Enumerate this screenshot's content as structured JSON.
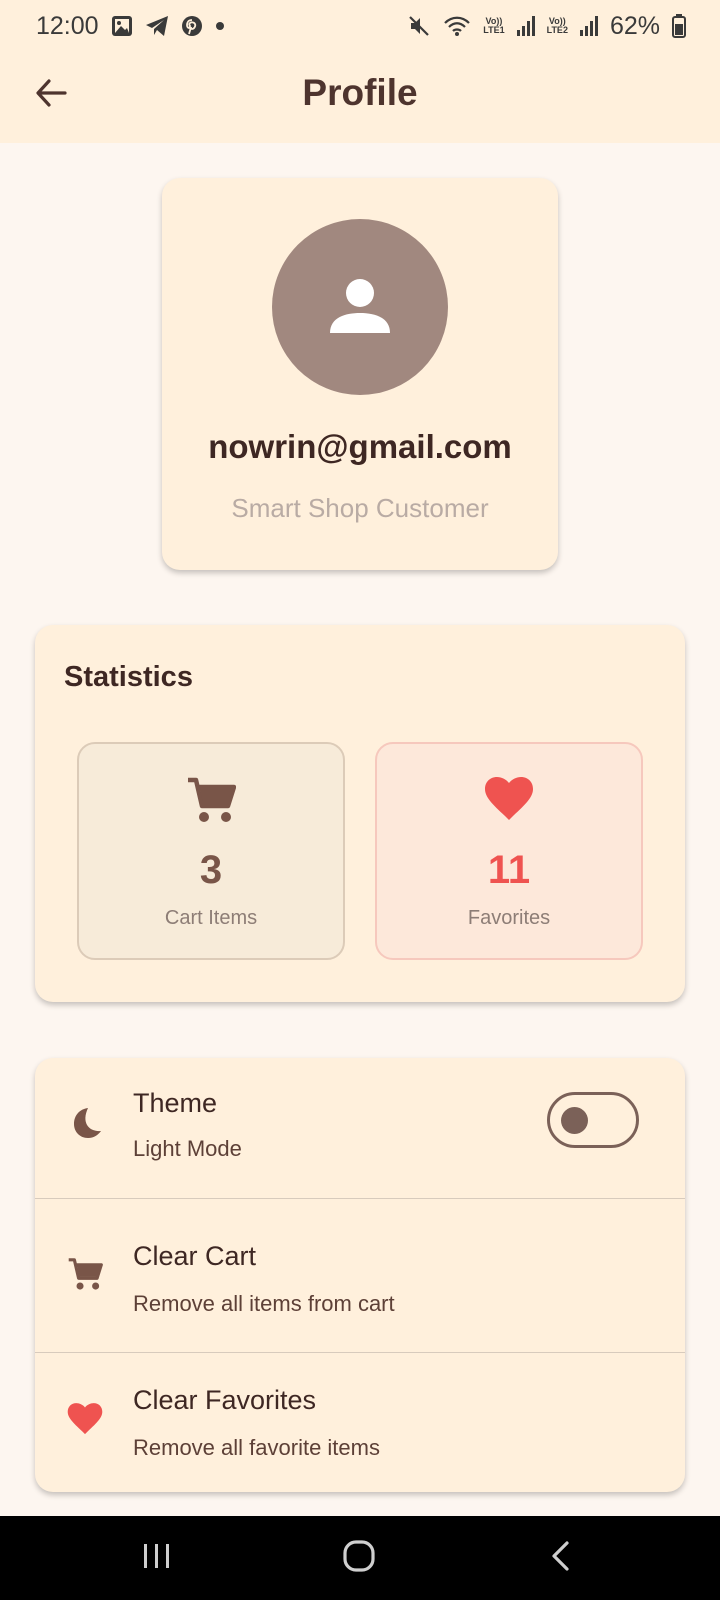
{
  "status_bar": {
    "time": "12:00",
    "battery": "62%",
    "lte1": "LTE1",
    "lte2": "LTE2",
    "volte": "Vo))"
  },
  "app_bar": {
    "title": "Profile",
    "back_icon": "arrow-left-icon"
  },
  "profile": {
    "avatar_icon": "person-icon",
    "email": "nowrin@gmail.com",
    "role": "Smart Shop Customer"
  },
  "statistics": {
    "title": "Statistics",
    "items": [
      {
        "icon": "cart-icon",
        "value": "3",
        "label": "Cart Items",
        "color": "#795548"
      },
      {
        "icon": "heart-icon",
        "value": "11",
        "label": "Favorites",
        "color": "#ef5350"
      }
    ]
  },
  "settings": {
    "items": [
      {
        "icon": "moon-icon",
        "title": "Theme",
        "subtitle": "Light Mode",
        "toggle_on": false
      },
      {
        "icon": "cart-icon",
        "title": "Clear Cart",
        "subtitle": "Remove all items from cart"
      },
      {
        "icon": "heart-icon",
        "title": "Clear Favorites",
        "subtitle": "Remove all favorite items"
      }
    ]
  },
  "colors": {
    "app_bar_bg": "#fff0dc",
    "page_bg": "#fdf6f0",
    "brown_primary": "#795548",
    "red_accent": "#ef5350"
  }
}
